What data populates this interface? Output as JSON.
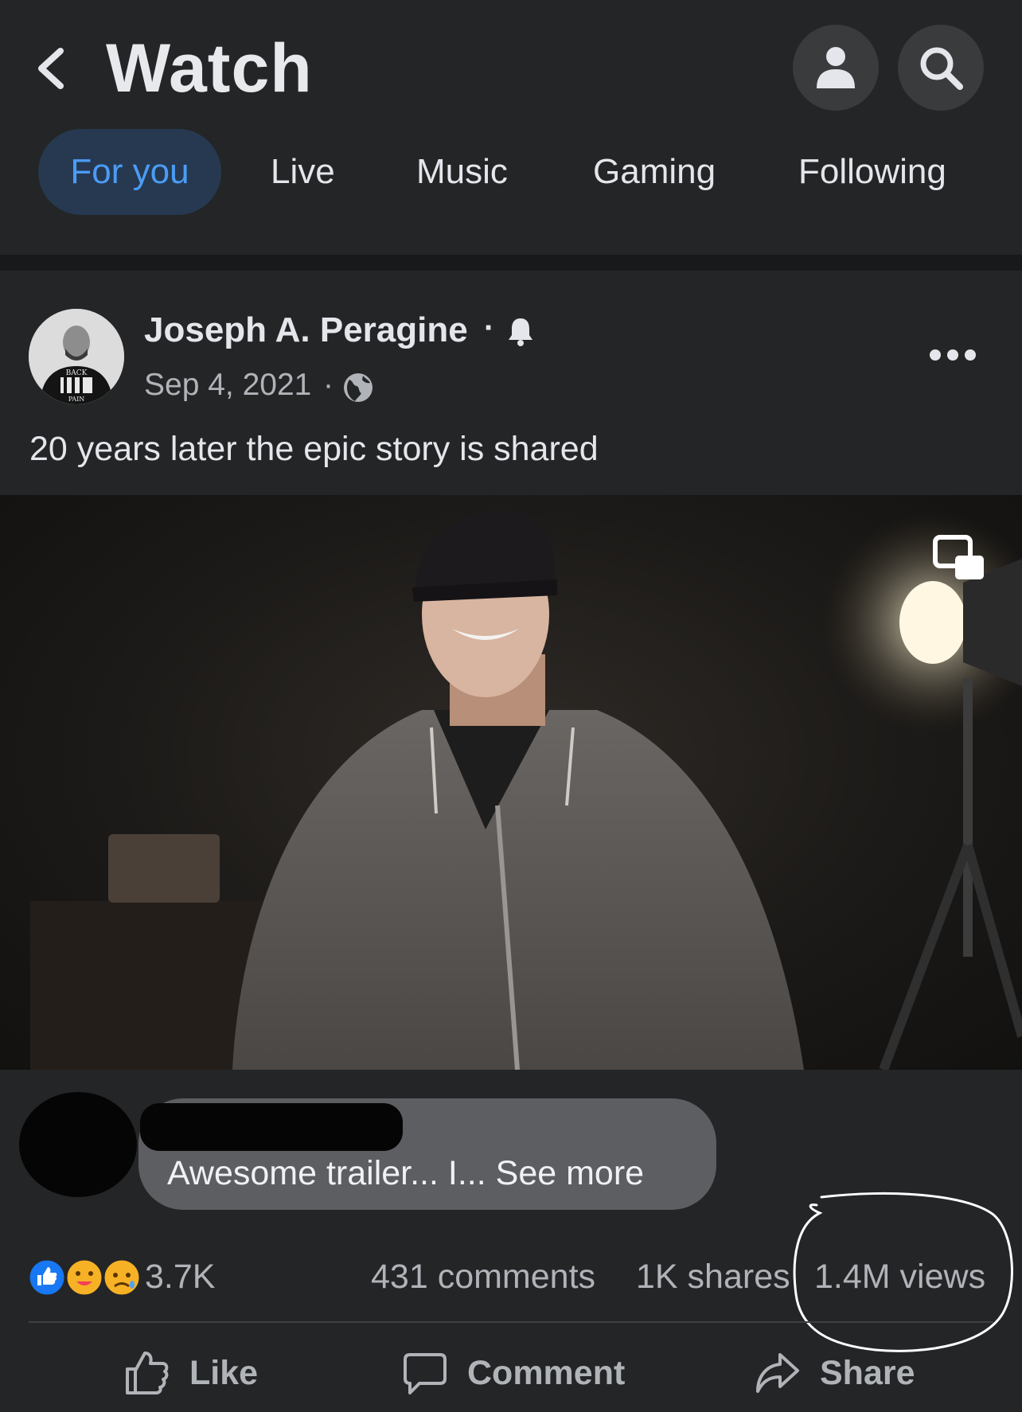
{
  "header": {
    "title": "Watch",
    "back_icon": "chevron-left-icon",
    "profile_icon": "person-icon",
    "search_icon": "search-icon"
  },
  "tabs": [
    {
      "label": "For you",
      "active": true
    },
    {
      "label": "Live",
      "active": false
    },
    {
      "label": "Music",
      "active": false
    },
    {
      "label": "Gaming",
      "active": false
    },
    {
      "label": "Following",
      "active": false
    }
  ],
  "post": {
    "author": "Joseph A. Peragine",
    "separator": "·",
    "date": "Sep 4, 2021",
    "caption": "20 years later the epic story is shared",
    "avatar_shirt_text": [
      "BACK",
      "PAIN"
    ]
  },
  "comment_preview": {
    "text": "Awesome trailer... I... See more"
  },
  "stats": {
    "reactions": "3.7K",
    "comments": "431 comments",
    "shares": "1K shares",
    "views": "1.4M views"
  },
  "actions": {
    "like": "Like",
    "comment": "Comment",
    "share": "Share"
  },
  "colors": {
    "background": "#242526",
    "active_tab_bg": "#263951",
    "active_tab_text": "#4b9cf5",
    "secondary_text": "#b0b3b8"
  }
}
